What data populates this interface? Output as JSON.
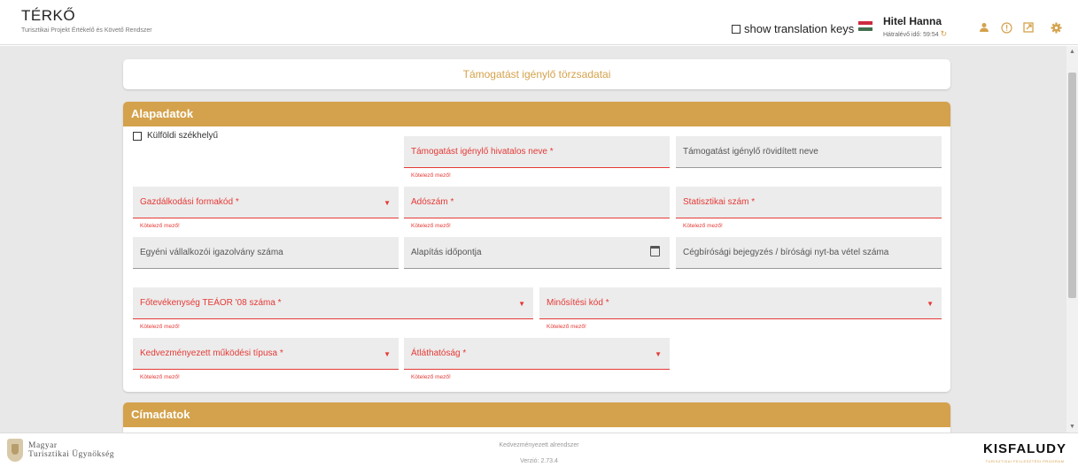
{
  "header": {
    "title": "TÉRKŐ",
    "subtitle": "Turisztikai Projekt Értékelő és Követő Rendszer",
    "translation_label": "show translation keys",
    "user_name": "Hitel Hanna",
    "remaining_time": "Hátralévő idő: 59:54"
  },
  "page": {
    "title": "Támogatást igénylő törzsadatai"
  },
  "basic": {
    "section_title": "Alapadatok",
    "foreign_hq_label": "Külföldi székhelyű",
    "official_name": "Támogatást igénylő hivatalos neve *",
    "short_name": "Támogatást igénylő rövidített neve",
    "legal_form": "Gazdálkodási formakód *",
    "tax_number": "Adószám *",
    "stat_number": "Statisztikai szám *",
    "entrepreneur_id": "Egyéni vállalkozói igazolvány száma",
    "founding_date": "Alapítás időpontja",
    "company_reg": "Cégbírósági bejegyzés / bírósági nyt-ba vétel száma",
    "teaor": "Főtevékenység TEÁOR '08 száma *",
    "qualification": "Minősítési kód *",
    "operation_type": "Kedvezményezett működési típusa *",
    "transparency": "Átláthatóság *",
    "required_hint": "Kötelező mező!"
  },
  "address": {
    "section_title": "Címadatok"
  },
  "footer": {
    "org_line1": "Magyar",
    "org_line2": "Turisztikai Ügynökség",
    "system": "Kedvezményezett alrendszer",
    "version": "Verzió: 2.73.4",
    "brand": "KISFALUDY",
    "brand_sub": "TURISZTIKAI FEJLESZTÉSI PROGRAM"
  },
  "colors": {
    "accent": "#d4a24c",
    "error": "#e53935"
  },
  "icons": [
    "person-icon",
    "info-icon",
    "external-link-icon",
    "gear-icon",
    "calendar-icon",
    "chevron-down-icon",
    "refresh-icon"
  ]
}
